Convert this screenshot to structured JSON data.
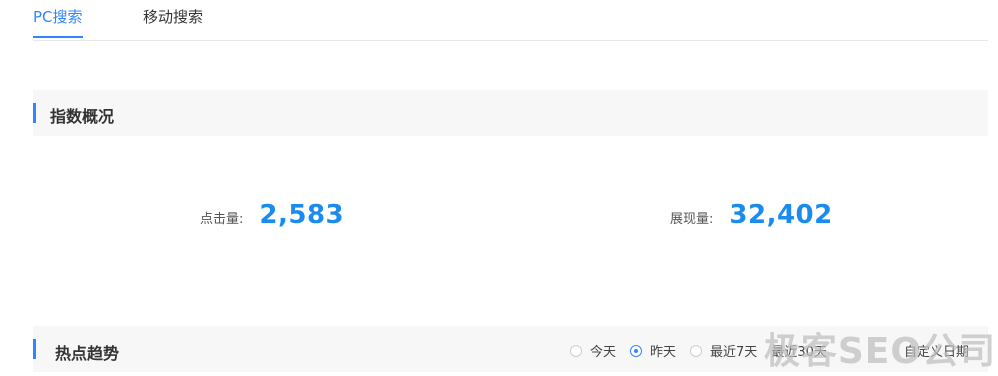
{
  "tabs": {
    "pc": "PC搜索",
    "mobile": "移动搜索"
  },
  "overview": {
    "title": "指数概况",
    "clicks": {
      "label": "点击量:",
      "value": "2,583"
    },
    "impressions": {
      "label": "展现量:",
      "value": "32,402"
    }
  },
  "trend": {
    "title": "热点趋势",
    "ranges": [
      "今天",
      "昨天",
      "最近7天",
      "最近30天"
    ],
    "selected": "昨天",
    "custom_label": "自定义日期"
  },
  "watermark": "极客SEO公司",
  "colors": {
    "accent": "#3385ff",
    "value": "#1a8cf0"
  }
}
